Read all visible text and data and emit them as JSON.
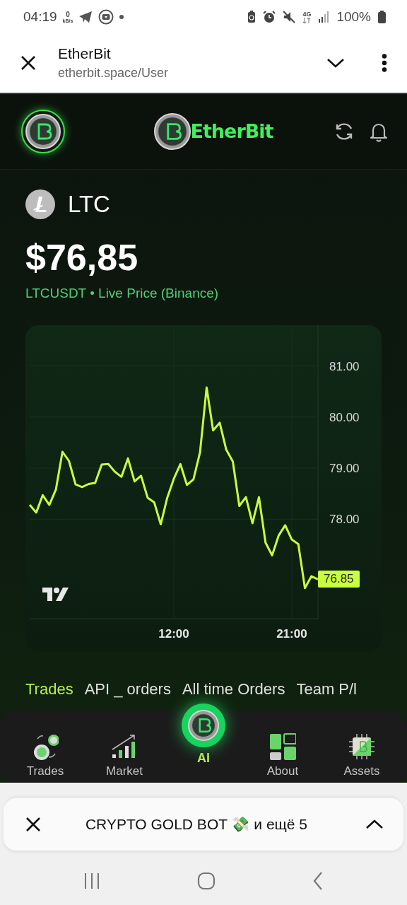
{
  "status_bar": {
    "time": "04:19",
    "speed_value": "0",
    "speed_unit": "kB/s",
    "network": "4G",
    "battery": "100%"
  },
  "browser_bar": {
    "title": "EtherBit",
    "url": "etherbit.space/User"
  },
  "app_header": {
    "brand": "EtherBit"
  },
  "coin": {
    "symbol": "LTC",
    "price": "$76,85",
    "source": "LTCUSDT • Live Price (Binance)"
  },
  "chart": {
    "price_tag": "76.85",
    "chart_data": {
      "type": "line",
      "x": [
        1,
        1.5,
        2,
        2.5,
        3,
        3.5,
        4,
        4.5,
        5,
        5.5,
        6,
        6.5,
        7,
        7.5,
        8,
        8.5,
        9,
        9.5,
        10,
        10.5,
        11,
        11.5,
        12,
        12.5,
        13,
        13.5,
        14,
        14.5,
        15,
        15.5,
        16,
        16.5,
        17,
        17.5,
        18,
        18.5,
        19,
        19.5,
        20,
        20.5,
        21,
        21.5,
        22,
        22.5,
        23
      ],
      "series": [
        {
          "color": "#c8ff3c",
          "values": [
            78.28,
            78.13,
            78.47,
            78.28,
            78.58,
            79.32,
            79.14,
            78.68,
            78.63,
            78.69,
            78.71,
            79.07,
            79.08,
            78.93,
            78.83,
            79.19,
            78.74,
            78.85,
            78.42,
            78.33,
            77.9,
            78.42,
            78.79,
            79.08,
            78.67,
            78.78,
            79.31,
            80.58,
            79.74,
            79.89,
            79.36,
            79.13,
            78.26,
            78.43,
            77.92,
            78.43,
            77.54,
            77.29,
            77.68,
            77.88,
            77.6,
            77.51,
            76.65,
            76.88,
            76.82
          ]
        }
      ],
      "xlim": [
        1,
        23
      ],
      "ylim": [
        76.05,
        81.8
      ],
      "grid": true,
      "xticks": [
        {
          "value": 12,
          "label": "12:00"
        },
        {
          "value": 21,
          "label": "21:00"
        }
      ],
      "yticks": [
        {
          "value": 81,
          "label": "81.00"
        },
        {
          "value": 80,
          "label": "80.00"
        },
        {
          "value": 79,
          "label": "79.00"
        },
        {
          "value": 78,
          "label": "78.00"
        }
      ]
    }
  },
  "tabs": [
    {
      "label": "Trades",
      "selected": true
    },
    {
      "label": "API _ orders",
      "selected": false
    },
    {
      "label": "All time Orders",
      "selected": false
    },
    {
      "label": "Team P/l",
      "selected": false
    }
  ],
  "bottom_nav": [
    {
      "label": "Trades",
      "kind": "coins"
    },
    {
      "label": "Market",
      "kind": "bars"
    },
    {
      "label": "AI",
      "kind": "center"
    },
    {
      "label": "About",
      "kind": "grid"
    },
    {
      "label": "Assets",
      "kind": "chip"
    }
  ],
  "notification": {
    "text": "CRYPTO GOLD BOT 💸 и ещё 5"
  }
}
